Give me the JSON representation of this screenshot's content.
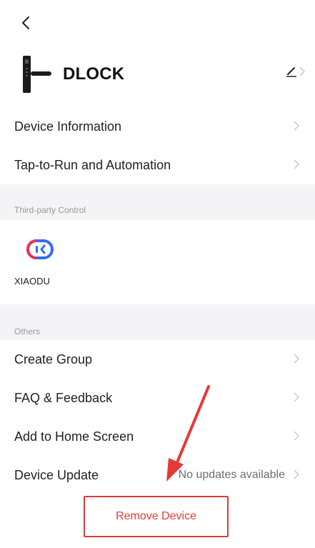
{
  "device": {
    "name": "DLOCK"
  },
  "rows": {
    "device_information": "Device Information",
    "tap_to_run": "Tap-to-Run and Automation",
    "create_group": "Create Group",
    "faq_feedback": "FAQ & Feedback",
    "add_home_screen": "Add to Home Screen",
    "device_update": "Device Update",
    "device_update_status": "No updates available"
  },
  "sections": {
    "third_party_title": "Third-party Control",
    "others_title": "Others"
  },
  "third_party": {
    "xiaodu_label": "XIAODU"
  },
  "remove": {
    "label": "Remove Device"
  },
  "colors": {
    "accent_red": "#e53935",
    "section_bg": "#f4f4f6",
    "chevron": "#c8c8c8",
    "xiaodu_blue": "#2f6df6",
    "xiaodu_red": "#e8344e"
  }
}
